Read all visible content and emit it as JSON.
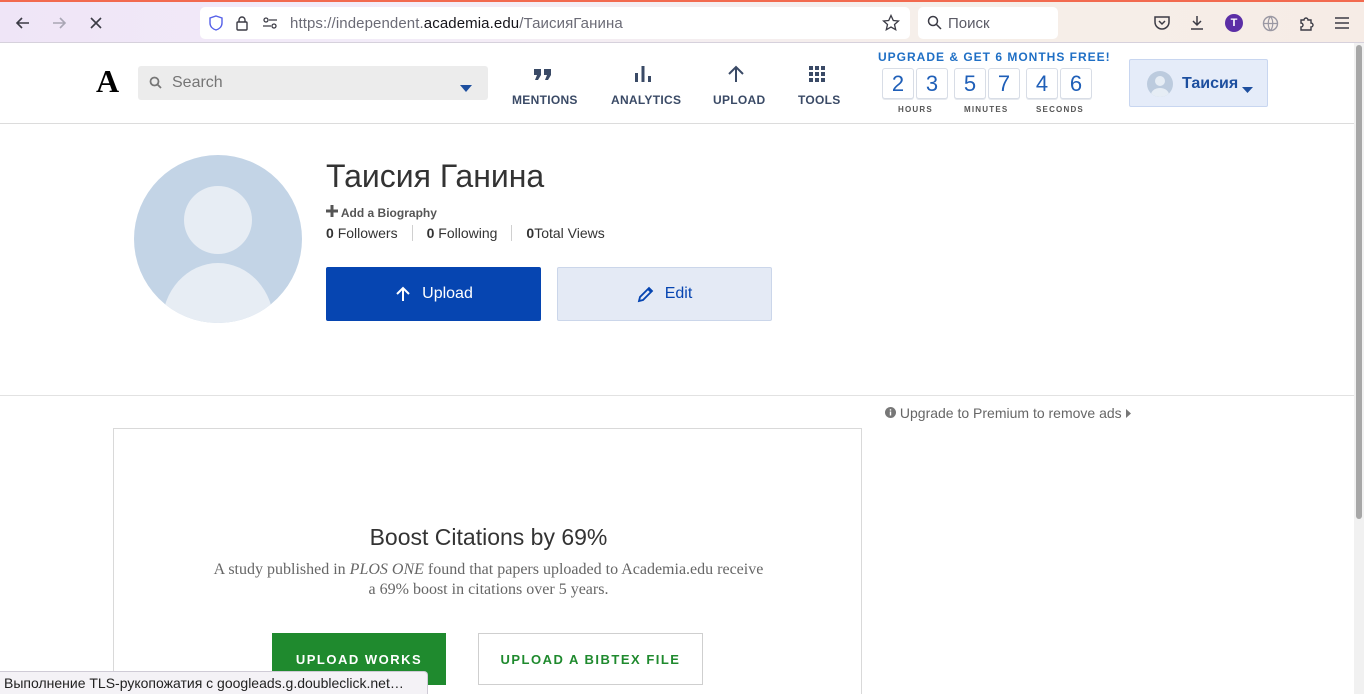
{
  "browser": {
    "url_prefix": "https://independent.",
    "url_domain": "academia.edu",
    "url_path": "/ТаисияГанина",
    "search_placeholder": "Поиск",
    "profile_initial": "T",
    "status_text": "Выполнение TLS-рукопожатия с googleads.g.doubleclick.net…"
  },
  "header": {
    "logo": "A",
    "search_placeholder": "Search",
    "nav": {
      "mentions": "MENTIONS",
      "analytics": "ANALYTICS",
      "upload": "UPLOAD",
      "tools": "TOOLS"
    },
    "promo": {
      "title": "UPGRADE & GET 6 MONTHS FREE!",
      "digits": [
        "2",
        "3",
        "5",
        "7",
        "4",
        "6"
      ],
      "labels": [
        "HOURS",
        "MINUTES",
        "SECONDS"
      ]
    },
    "user_name": "Таисия"
  },
  "profile": {
    "name": "Таисия Ганина",
    "add_bio": "Add a Biography",
    "followers_count": "0",
    "followers_label": "Followers",
    "following_count": "0",
    "following_label": "Following",
    "views_count": "0",
    "views_label": "Total Views",
    "upload_label": "Upload",
    "edit_label": "Edit"
  },
  "ads": {
    "premium_text": "Upgrade to Premium to remove ads"
  },
  "boost": {
    "title": "Boost Citations by 69%",
    "text_before": "A study published in ",
    "journal": "PLOS ONE",
    "text_after": " found that papers uploaded to Academia.edu receive a 69% boost in citations over 5 years.",
    "upload_works": "UPLOAD WORKS",
    "upload_bibtex": "UPLOAD A BIBTEX FILE"
  },
  "colors": {
    "primary": "#0645b1",
    "green": "#1f8a2e",
    "promo_blue": "#1f6fc5"
  }
}
